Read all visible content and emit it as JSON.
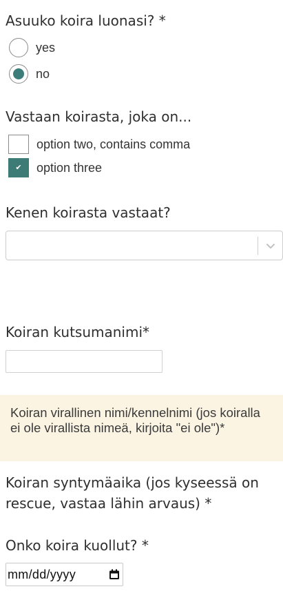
{
  "q1": {
    "title": "Asuuko koira luonasi? *",
    "options": [
      {
        "label": "yes",
        "selected": false
      },
      {
        "label": "no",
        "selected": true
      }
    ]
  },
  "q2": {
    "title": "Vastaan koirasta, joka on...",
    "options": [
      {
        "label": "option two, contains comma",
        "checked": false
      },
      {
        "label": "option three",
        "checked": true
      }
    ]
  },
  "q3": {
    "title": "Kenen koirasta vastaat?",
    "selected_value": ""
  },
  "q4": {
    "title": "Koiran kutsumanimi*",
    "value": ""
  },
  "note": {
    "text": "Koiran virallinen nimi/kennelnimi (jos koiralla ei ole virallista nimeä, kirjoita \"ei ole\")*"
  },
  "q5": {
    "title": "Koiran syntymäaika (jos kyseessä on rescue, vastaa lähin arvaus) *"
  },
  "q6": {
    "title": "Onko koira kuollut? *",
    "date_placeholder": "mm/dd/yyyy"
  },
  "colors": {
    "accent": "#3d7b77",
    "note_background": "#fbf4e3"
  }
}
